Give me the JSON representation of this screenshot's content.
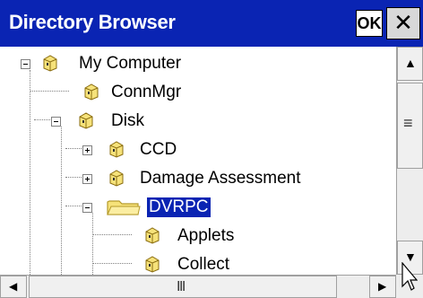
{
  "window": {
    "title": "Directory Browser",
    "ok_label": "OK",
    "close_label": "✕"
  },
  "tree": {
    "items": [
      {
        "label": "My Computer",
        "expander": "minus",
        "icon": "computer-icon",
        "selected": false
      },
      {
        "label": "ConnMgr",
        "expander": "none",
        "icon": "folder-icon",
        "selected": false
      },
      {
        "label": "Disk",
        "expander": "minus",
        "icon": "folder-icon",
        "selected": false
      },
      {
        "label": "CCD",
        "expander": "plus",
        "icon": "folder-icon",
        "selected": false
      },
      {
        "label": "Damage Assessment",
        "expander": "plus",
        "icon": "folder-icon",
        "selected": false
      },
      {
        "label": "DVRPC",
        "expander": "minus",
        "icon": "open-folder-icon",
        "selected": true
      },
      {
        "label": "Applets",
        "expander": "none",
        "icon": "folder-icon",
        "selected": false
      },
      {
        "label": "Collect",
        "expander": "none",
        "icon": "folder-icon",
        "selected": false
      }
    ]
  },
  "scrollbars": {
    "up_arrow": "▲",
    "down_arrow": "▼",
    "left_arrow": "◀",
    "right_arrow": "▶",
    "v_grip": "≡",
    "h_grip": "Ⅲ"
  },
  "colors": {
    "title_bg": "#0a24b3",
    "folder": "#f6e27a",
    "folder_dark": "#b59a2a",
    "selection": "#0a24b3"
  }
}
